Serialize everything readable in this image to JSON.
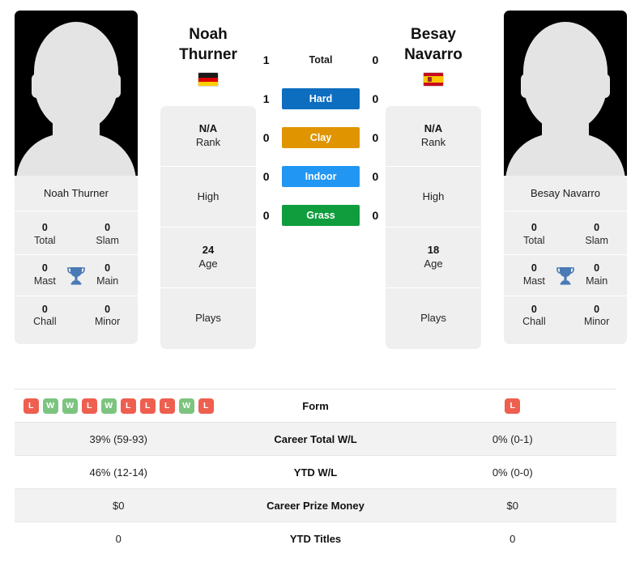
{
  "players": {
    "left": {
      "first_name": "Noah",
      "last_name": "Thurner",
      "full_name": "Noah Thurner",
      "country_flag": "de-flag-icon",
      "rank": "N/A",
      "rank_label": "Rank",
      "high_value": "",
      "high_label": "High",
      "age": "24",
      "age_label": "Age",
      "plays_value": "",
      "plays_label": "Plays",
      "titles": {
        "total_value": "0",
        "total_label": "Total",
        "slam_value": "0",
        "slam_label": "Slam",
        "mast_value": "0",
        "mast_label": "Mast",
        "main_value": "0",
        "main_label": "Main",
        "chall_value": "0",
        "chall_label": "Chall",
        "minor_value": "0",
        "minor_label": "Minor"
      },
      "form": [
        "L",
        "W",
        "W",
        "L",
        "W",
        "L",
        "L",
        "L",
        "W",
        "L"
      ],
      "career_wl": "39% (59-93)",
      "ytd_wl": "46% (12-14)",
      "career_prize": "$0",
      "ytd_titles": "0"
    },
    "right": {
      "first_name": "Besay",
      "last_name": "Navarro",
      "full_name": "Besay Navarro",
      "country_flag": "es-flag-icon",
      "rank": "N/A",
      "rank_label": "Rank",
      "high_value": "",
      "high_label": "High",
      "age": "18",
      "age_label": "Age",
      "plays_value": "",
      "plays_label": "Plays",
      "titles": {
        "total_value": "0",
        "total_label": "Total",
        "slam_value": "0",
        "slam_label": "Slam",
        "mast_value": "0",
        "mast_label": "Mast",
        "main_value": "0",
        "main_label": "Main",
        "chall_value": "0",
        "chall_label": "Chall",
        "minor_value": "0",
        "minor_label": "Minor"
      },
      "form": [
        "L"
      ],
      "career_wl": "0% (0-1)",
      "ytd_wl": "0% (0-0)",
      "career_prize": "$0",
      "ytd_titles": "0"
    }
  },
  "head_to_head": [
    {
      "label": "Total",
      "left": "1",
      "right": "0",
      "color": "",
      "text_color": "#1a1a1a"
    },
    {
      "label": "Hard",
      "left": "1",
      "right": "0",
      "color": "#0d6dbf",
      "text_color": "#ffffff"
    },
    {
      "label": "Clay",
      "left": "0",
      "right": "0",
      "color": "#e09400",
      "text_color": "#ffffff"
    },
    {
      "label": "Indoor",
      "left": "0",
      "right": "0",
      "color": "#2196f3",
      "text_color": "#ffffff"
    },
    {
      "label": "Grass",
      "left": "0",
      "right": "0",
      "color": "#0f9d3e",
      "text_color": "#ffffff"
    }
  ],
  "stats_rows": [
    {
      "label": "Form",
      "type": "form",
      "left": "",
      "right": ""
    },
    {
      "label": "Career Total W/L",
      "type": "text",
      "left": "39% (59-93)",
      "right": "0% (0-1)"
    },
    {
      "label": "YTD W/L",
      "type": "text",
      "left": "46% (12-14)",
      "right": "0% (0-0)"
    },
    {
      "label": "Career Prize Money",
      "type": "text",
      "left": "$0",
      "right": "$0"
    },
    {
      "label": "YTD Titles",
      "type": "text",
      "left": "0",
      "right": "0"
    }
  ],
  "colors": {
    "win": "#7cc47f",
    "loss": "#ee5f4f",
    "trophy": "#4a7ab5",
    "card_bg": "#efefef",
    "row_shade": "#f2f2f2"
  },
  "icons": {
    "trophy": "trophy-icon"
  }
}
